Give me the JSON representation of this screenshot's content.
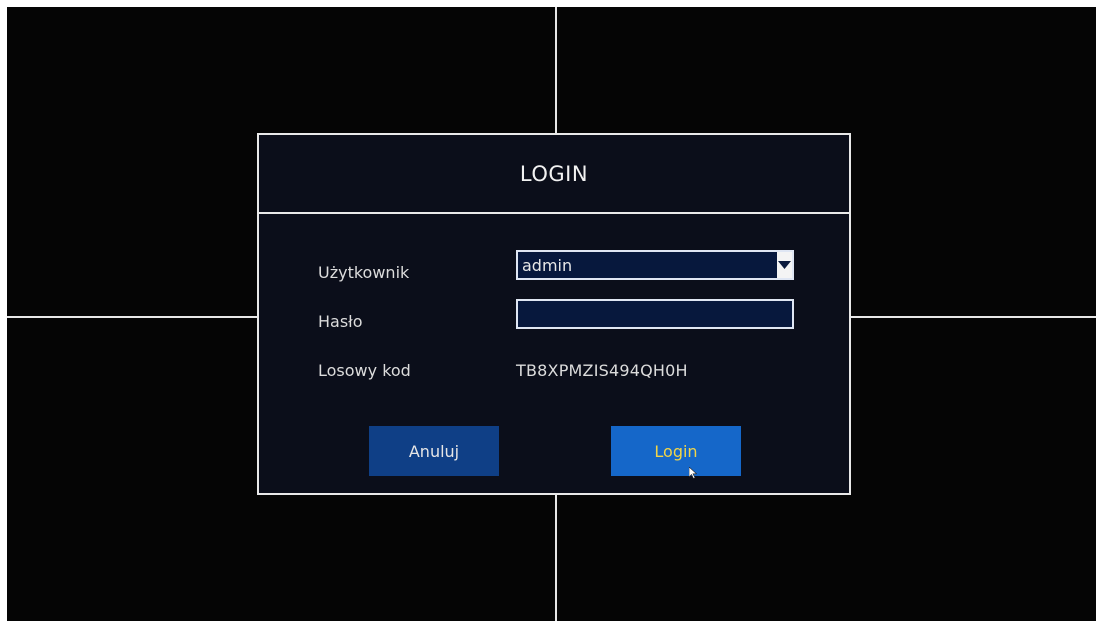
{
  "dialog": {
    "title": "LOGIN",
    "user_label": "Użytkownik",
    "user_value": "admin",
    "password_label": "Hasło",
    "password_value": "",
    "code_label": "Losowy kod",
    "code_value": "TB8XPMZIS494QH0H",
    "cancel_label": "Anuluj",
    "login_label": "Login"
  },
  "icons": {
    "dropdown": "chevron-down-icon",
    "cursor": "mouse-cursor-icon"
  },
  "colors": {
    "screen_bg": "#050505",
    "dialog_bg": "#0b0e1a",
    "field_bg": "#07183d",
    "cancel_button": "#0f3f86",
    "login_button": "#1567c9",
    "login_text": "#f2d548"
  }
}
